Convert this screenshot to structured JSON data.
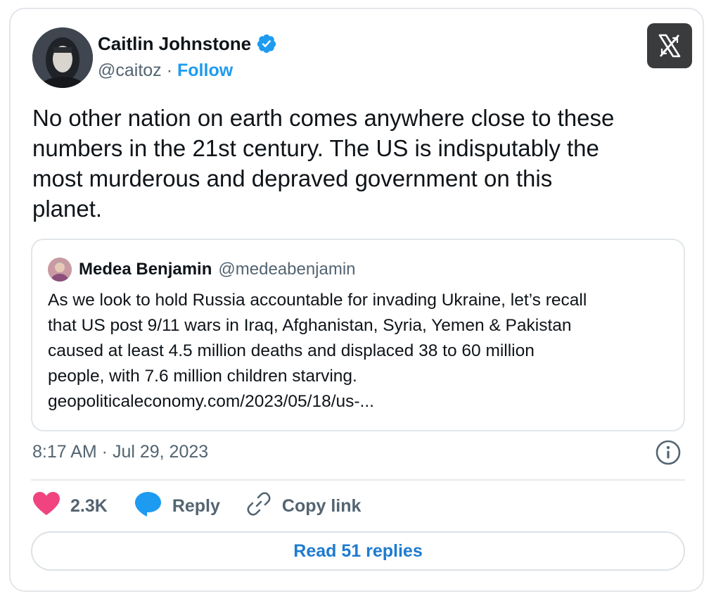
{
  "author": {
    "name": "Caitlin Johnstone",
    "handle": "@caitoz",
    "separator": "·",
    "follow_label": "Follow",
    "verified_icon": "verified-badge-icon"
  },
  "tweet": {
    "text_lines": [
      "No other nation on earth comes anywhere close to these",
      "numbers in the 21st century. The US is indisputably the",
      "most murderous and depraved government on this",
      "planet."
    ],
    "timestamp": "8:17 AM · Jul 29, 2023"
  },
  "quote": {
    "name": "Medea Benjamin",
    "handle": "@medeabenjamin",
    "text_lines": [
      "As we look to hold Russia accountable for invading Ukraine, let’s recall",
      "that US post 9/11 wars in Iraq, Afghanistan, Syria, Yemen & Pakistan",
      "caused at least 4.5 million deaths and displaced 38 to 60 million",
      "people, with 7.6 million children starving.",
      "geopoliticaleconomy.com/2023/05/18/us-..."
    ]
  },
  "actions": {
    "like_count": "2.3K",
    "reply_label": "Reply",
    "copy_link_label": "Copy link"
  },
  "read_replies_label": "Read 51 replies",
  "colors": {
    "accent": "#1d9bf0",
    "like": "#f0437f",
    "reply": "#1d9bf0",
    "muted": "#536471",
    "x_button_bg": "#3a3b3d"
  }
}
